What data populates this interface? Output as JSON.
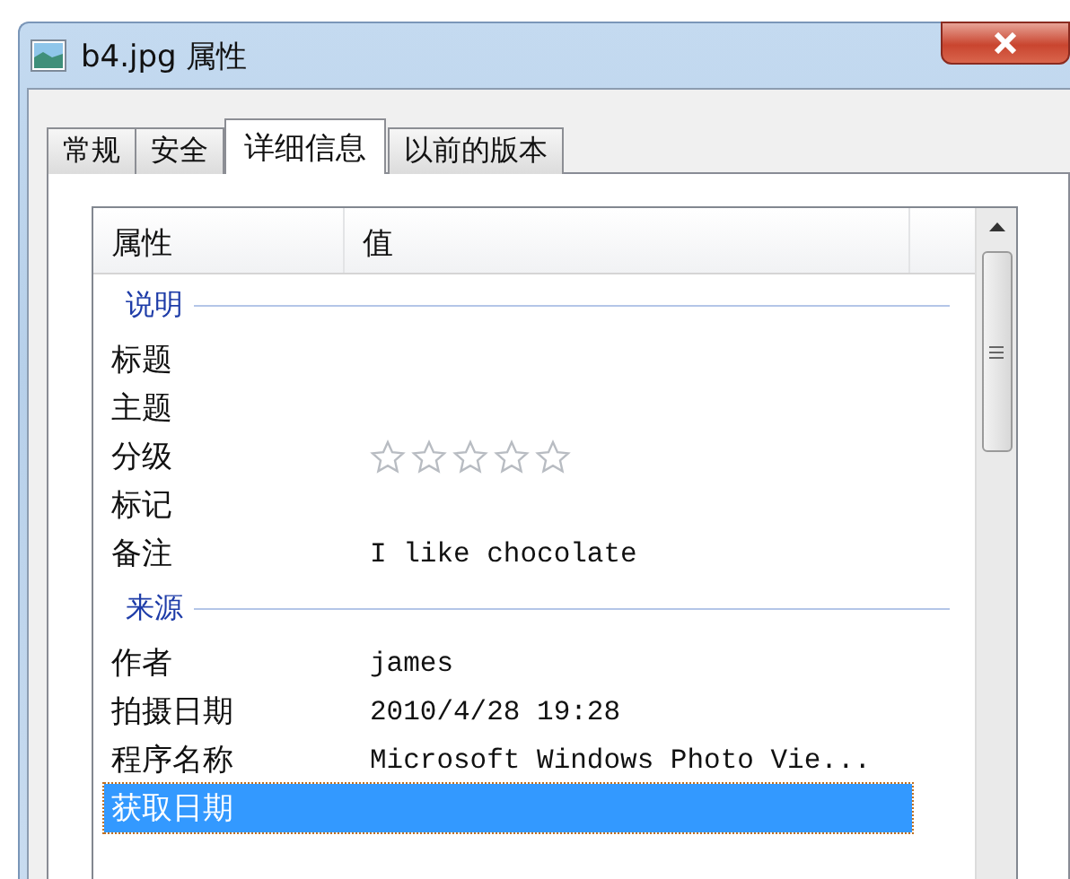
{
  "window": {
    "title": "b4.jpg 属性"
  },
  "tabs": [
    {
      "label": "常规",
      "selected": false
    },
    {
      "label": "安全",
      "selected": false
    },
    {
      "label": "详细信息",
      "selected": true
    },
    {
      "label": "以前的版本",
      "selected": false
    }
  ],
  "table": {
    "columns": [
      "属性",
      "值"
    ],
    "rows": [
      {
        "kind": "group",
        "label": "说明"
      },
      {
        "kind": "text",
        "label": "标题",
        "selected": false
      },
      {
        "kind": "text",
        "label": "主题",
        "selected": false
      },
      {
        "kind": "rating",
        "label": "分级",
        "stars": 0,
        "selected": false
      },
      {
        "kind": "text",
        "label": "标记",
        "selected": false
      },
      {
        "kind": "text",
        "label": "备注",
        "value": "I like chocolate",
        "selected": false
      },
      {
        "kind": "group",
        "label": "来源"
      },
      {
        "kind": "text",
        "label": "作者",
        "value": "james",
        "selected": false
      },
      {
        "kind": "text",
        "label": "拍摄日期",
        "value": "2010/4/28 19:28",
        "selected": false
      },
      {
        "kind": "text",
        "label": "程序名称",
        "value": "Microsoft Windows Photo Vie...",
        "selected": false
      },
      {
        "kind": "text",
        "label": "获取日期",
        "selected": true
      }
    ]
  }
}
